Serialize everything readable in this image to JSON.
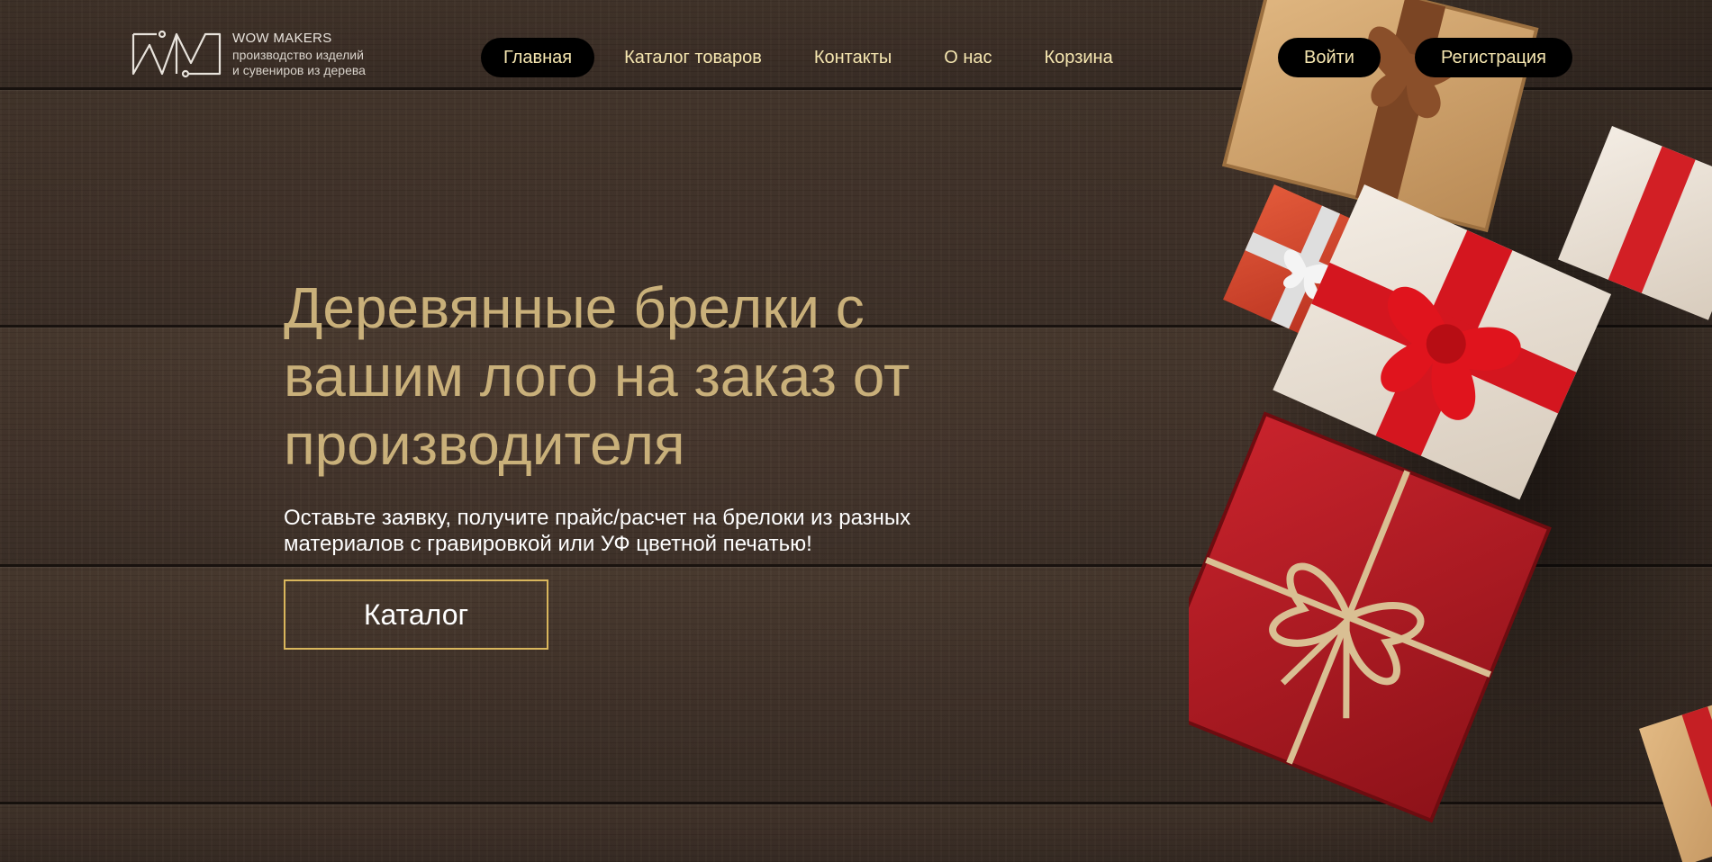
{
  "brand": {
    "name": "WOW MAKERS",
    "tagline_line1": "производство изделий",
    "tagline_line2": "и сувениров из дерева"
  },
  "nav": {
    "items": [
      {
        "label": "Главная",
        "active": true
      },
      {
        "label": "Каталог товаров",
        "active": false
      },
      {
        "label": "Контакты",
        "active": false
      },
      {
        "label": "О нас",
        "active": false
      },
      {
        "label": "Корзина",
        "active": false
      }
    ]
  },
  "auth": {
    "login_label": "Войти",
    "register_label": "Регистрация"
  },
  "hero": {
    "title": "Деревянные брелки с вашим лого на заказ от производителя",
    "subtitle_line1": "Оставьте заявку, получите прайс/расчет на брелоки из разных",
    "subtitle_line2": "материалов с гравировкой или УФ цветной печатью!",
    "cta_label": "Каталог"
  },
  "colors": {
    "accent_gold": "#c9b07a",
    "nav_text": "#f5e6b0",
    "button_border": "#d9b65c",
    "pill_bg": "#000000",
    "wood": "#4a3a2f"
  },
  "icons": {
    "logo": "wm-monogram-logo"
  }
}
